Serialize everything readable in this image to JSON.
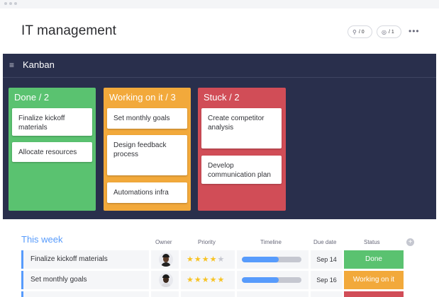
{
  "board": {
    "title": "IT management",
    "invite_count": "/ 0",
    "subscribers_count": "/ 1",
    "more_label": "•••"
  },
  "kanban": {
    "title": "Kanban",
    "columns": [
      {
        "label": "Done / 2",
        "color": "#5ac270",
        "cards": [
          "Finalize kickoff materials",
          "Allocate resources"
        ]
      },
      {
        "label": "Working on it / 3",
        "color": "#f2a93b",
        "cards": [
          "Set monthly goals",
          "Design feedback process",
          "Automations infra"
        ]
      },
      {
        "label": "Stuck / 2",
        "color": "#d14d57",
        "cards": [
          "Create competitor analysis",
          "Develop communication plan"
        ]
      }
    ]
  },
  "table": {
    "group_title": "This week",
    "group_color": "#579bfc",
    "headers": {
      "owner": "Owner",
      "priority": "Priority",
      "timeline": "Timeline",
      "due": "Due date",
      "status": "Status"
    },
    "rows": [
      {
        "name": "Finalize kickoff materials",
        "priority": 4,
        "timeline_progress": 0.62,
        "due": "Sep 14",
        "status": "Done",
        "status_color": "#5ac270"
      },
      {
        "name": "Set monthly goals",
        "priority": 5,
        "timeline_progress": 0.62,
        "due": "Sep 16",
        "status": "Working on it",
        "status_color": "#f2a93b"
      }
    ]
  }
}
